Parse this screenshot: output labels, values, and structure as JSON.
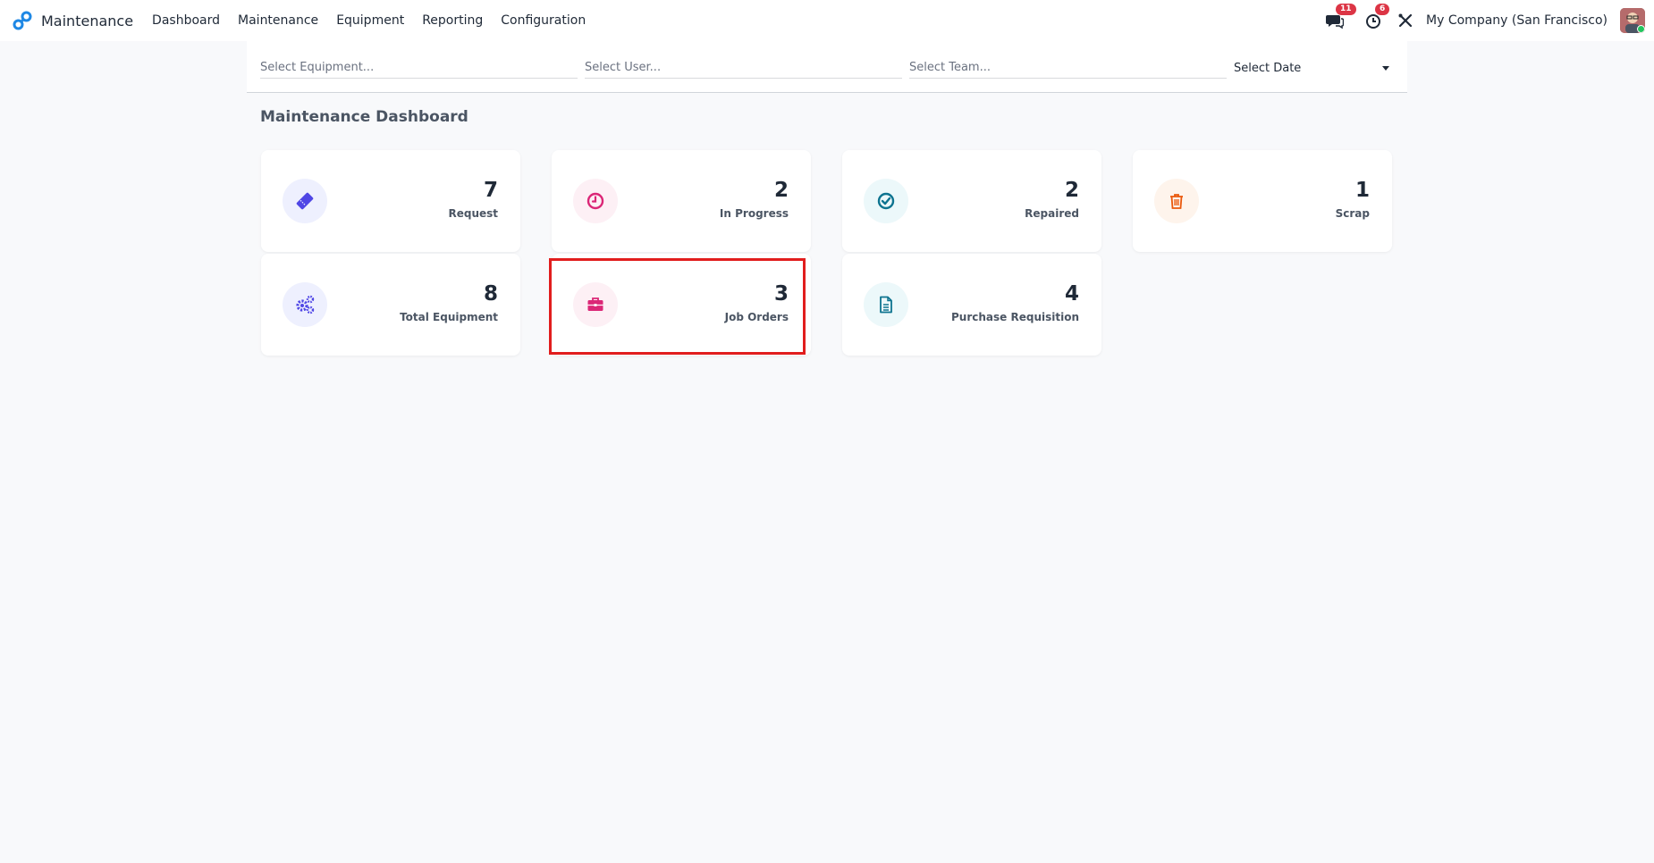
{
  "app": {
    "name": "Maintenance",
    "menu": [
      "Dashboard",
      "Maintenance",
      "Equipment",
      "Reporting",
      "Configuration"
    ],
    "messages_badge": "11",
    "activities_badge": "6",
    "company": "My Company (San Francisco)"
  },
  "filters": {
    "equipment_placeholder": "Select Equipment...",
    "user_placeholder": "Select User...",
    "team_placeholder": "Select Team...",
    "date_label": "Select Date"
  },
  "dashboard": {
    "title": "Maintenance Dashboard",
    "cards": [
      {
        "value": "7",
        "label": "Request",
        "icon": "ticket-icon",
        "color": "#4f46e5",
        "bg": "#eef0fe"
      },
      {
        "value": "2",
        "label": "In Progress",
        "icon": "clock-icon",
        "color": "#db2777",
        "bg": "#fdf0f5"
      },
      {
        "value": "2",
        "label": "Repaired",
        "icon": "check-circle-icon",
        "color": "#0e7490",
        "bg": "#ecf8fa"
      },
      {
        "value": "1",
        "label": "Scrap",
        "icon": "trash-icon",
        "color": "#ea580c",
        "bg": "#fef4ec"
      },
      {
        "value": "8",
        "label": "Total Equipment",
        "icon": "gears-icon",
        "color": "#4f46e5",
        "bg": "#eef0fe"
      },
      {
        "value": "3",
        "label": "Job Orders",
        "icon": "briefcase-icon",
        "color": "#db2777",
        "bg": "#fdf0f5"
      },
      {
        "value": "4",
        "label": "Purchase Requisition",
        "icon": "document-icon",
        "color": "#0e7490",
        "bg": "#ecf8fa"
      }
    ]
  },
  "colors": {
    "highlight": "#e11d1d",
    "badge": "#dc3545",
    "background": "#f8f9fb"
  }
}
